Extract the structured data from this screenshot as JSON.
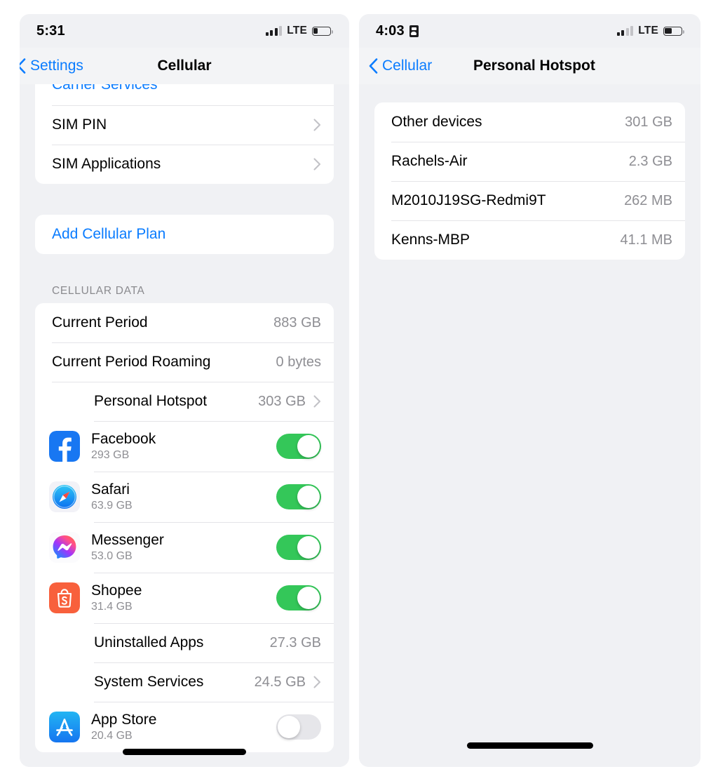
{
  "left_screen": {
    "status_bar": {
      "time": "5:31",
      "network_label": "LTE",
      "signal_bars_active": 3,
      "signal_bars_total": 4,
      "battery_percent": 25
    },
    "nav": {
      "back_label": "Settings",
      "title": "Cellular"
    },
    "sections": [
      {
        "name": "sim-section",
        "rows": [
          {
            "label": "Carrier Services",
            "style": "link",
            "clipped": true
          },
          {
            "label": "SIM PIN",
            "chevron": true
          },
          {
            "label": "SIM Applications",
            "chevron": true
          }
        ]
      },
      {
        "name": "add-plan-section",
        "rows": [
          {
            "label": "Add Cellular Plan",
            "style": "link"
          }
        ]
      },
      {
        "name": "cellular-data-section",
        "header": "CELLULAR DATA",
        "rows": [
          {
            "label": "Current Period",
            "value": "883 GB"
          },
          {
            "label": "Current Period Roaming",
            "value": "0 bytes"
          },
          {
            "label": "Personal Hotspot",
            "value": "303 GB",
            "chevron": true,
            "indent": true
          },
          {
            "label": "Facebook",
            "size": "293 GB",
            "icon": "facebook-icon",
            "toggle": "on"
          },
          {
            "label": "Safari",
            "size": "63.9 GB",
            "icon": "safari-icon",
            "toggle": "on"
          },
          {
            "label": "Messenger",
            "size": "53.0 GB",
            "icon": "messenger-icon",
            "toggle": "on"
          },
          {
            "label": "Shopee",
            "size": "31.4 GB",
            "icon": "shopee-icon",
            "toggle": "on"
          },
          {
            "label": "Uninstalled Apps",
            "value": "27.3 GB",
            "indent": true
          },
          {
            "label": "System Services",
            "value": "24.5 GB",
            "chevron": true,
            "indent": true
          },
          {
            "label": "App Store",
            "size": "20.4 GB",
            "icon": "app-store-icon",
            "toggle": "off"
          }
        ]
      }
    ]
  },
  "right_screen": {
    "status_bar": {
      "time": "4:03",
      "indicator_icon": "hotspot-lock-icon",
      "network_label": "LTE",
      "signal_bars_active": 2,
      "signal_bars_total": 4,
      "battery_percent": 42
    },
    "nav": {
      "back_label": "Cellular",
      "title": "Personal Hotspot"
    },
    "devices": [
      {
        "label": "Other devices",
        "value": "301 GB"
      },
      {
        "label": "Rachels-Air",
        "value": "2.3 GB"
      },
      {
        "label": "M2010J19SG-Redmi9T",
        "value": "262 MB"
      },
      {
        "label": "Kenns-MBP",
        "value": "41.1 MB"
      }
    ]
  },
  "colors": {
    "tint_blue": "#0a7cff",
    "toggle_on_green": "#34c759",
    "toggle_off_gray": "#e6e6ea",
    "page_background": "#f0f1f4",
    "card_background": "#ffffff",
    "secondary_text": "#8e8e93"
  }
}
